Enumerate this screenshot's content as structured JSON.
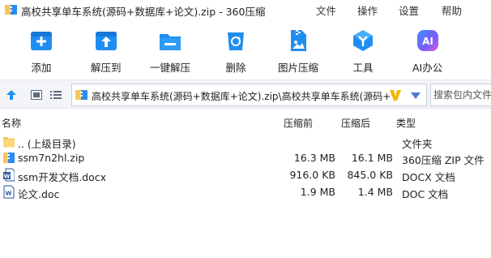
{
  "window": {
    "title": "高校共享单车系统(源码+数据库+论文).zip - 360压缩"
  },
  "menu": {
    "file": "文件",
    "operations": "操作",
    "settings": "设置",
    "help": "帮助"
  },
  "toolbar": {
    "add": "添加",
    "extract_to": "解压到",
    "one_click_extract": "一键解压",
    "delete": "删除",
    "image_compress": "图片压缩",
    "tools": "工具",
    "ai_office": "AI办公"
  },
  "address": {
    "path": "高校共享单车系统(源码+数据库+论文).zip\\高校共享单车系统(源码+数",
    "search_placeholder": "搜索包内文件"
  },
  "columns": {
    "name": "名称",
    "packed": "压缩前",
    "size": "压缩后",
    "type": "类型"
  },
  "files": [
    {
      "name": ".. (上级目录)",
      "packed": "",
      "size": "",
      "type": "文件夹",
      "icon": "folder-icon"
    },
    {
      "name": "ssm7n2hl.zip",
      "packed": "16.3 MB",
      "size": "16.1 MB",
      "type": "360压缩 ZIP 文件",
      "icon": "zip-icon"
    },
    {
      "name": "ssm开发文档.docx",
      "packed": "916.0 KB",
      "size": "845.0 KB",
      "type": "DOCX 文档",
      "icon": "docx-icon"
    },
    {
      "name": "论文.doc",
      "packed": "1.9 MB",
      "size": "1.4 MB",
      "type": "DOC 文档",
      "icon": "doc-icon"
    }
  ],
  "colors": {
    "toolbar_blue": "#1f8ef1",
    "address_bg": "#f2f4f7",
    "zip_blue": "#2d8cf0",
    "folder_yellow": "#f6c65b"
  }
}
